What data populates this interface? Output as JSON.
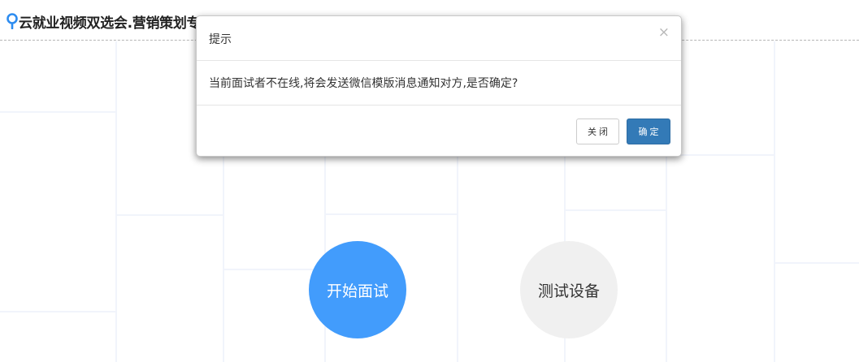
{
  "header": {
    "title": "云就业视频双选会.营销策划专场"
  },
  "main": {
    "start_interview_label": "开始面试",
    "test_device_label": "测试设备"
  },
  "modal": {
    "title": "提示",
    "close_icon": "×",
    "message": "当前面试者不在线,将会发送微信模版消息通知对方,是否确定?",
    "close_button_label": "关闭",
    "confirm_button_label": "确定"
  },
  "colors": {
    "accent_blue": "#429cfc",
    "confirm_blue": "#337ab7",
    "test_button_bg": "#f0f0f0"
  }
}
